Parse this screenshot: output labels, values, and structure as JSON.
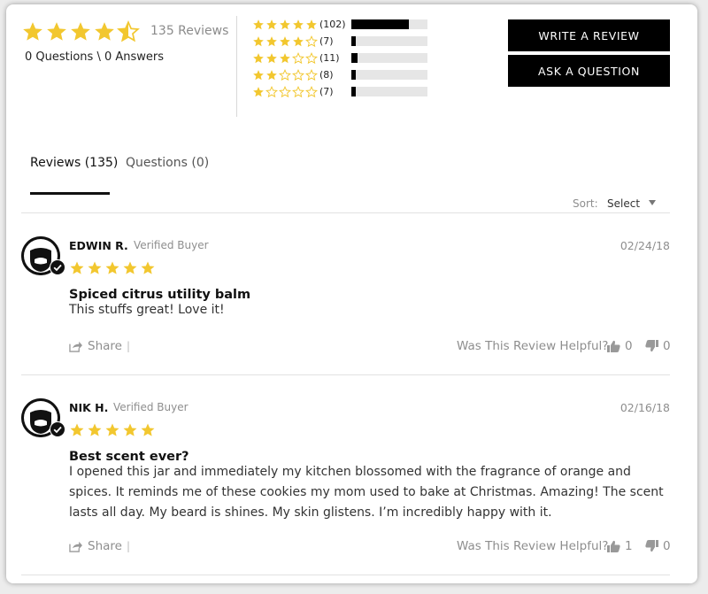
{
  "summary": {
    "rating": 4.5,
    "review_count": "135 Reviews",
    "qa_count": "0 Questions \\ 0 Answers"
  },
  "histogram": [
    {
      "stars": 5,
      "count": "(102)",
      "fraction": 0.755
    },
    {
      "stars": 4,
      "count": "(7)",
      "fraction": 0.052
    },
    {
      "stars": 3,
      "count": "(11)",
      "fraction": 0.081
    },
    {
      "stars": 2,
      "count": "(8)",
      "fraction": 0.059
    },
    {
      "stars": 1,
      "count": "(7)",
      "fraction": 0.052
    }
  ],
  "actions": {
    "write_review": "WRITE A REVIEW",
    "ask_question": "ASK A QUESTION"
  },
  "tabs": {
    "reviews": "Reviews (135)",
    "questions": "Questions (0)"
  },
  "sort": {
    "label": "Sort:",
    "value": "Select"
  },
  "reviews": [
    {
      "name": "EDWIN R.",
      "badge": "Verified Buyer",
      "date": "02/24/18",
      "rating": 5,
      "title": "Spiced citrus utility balm",
      "body": "This stuffs great! Love it!",
      "share": "Share",
      "pipe": "|",
      "helpful": "Was This Review Helpful?",
      "up": "0",
      "down": "0"
    },
    {
      "name": "NIK H.",
      "badge": "Verified Buyer",
      "date": "02/16/18",
      "rating": 5,
      "title": "Best scent ever?",
      "body": "I opened this jar and immediately my kitchen blossomed with the fragrance of orange and spices. It reminds me of these cookies my mom used to bake at Christmas. Amazing! The scent lasts all day. My beard is shines. My skin glistens. I’m incredibly happy with it.",
      "share": "Share",
      "pipe": "|",
      "helpful": "Was This Review Helpful?",
      "up": "1",
      "down": "0"
    }
  ],
  "colors": {
    "star": "#f2c72f",
    "button_bg": "#000000",
    "muted_text": "#8e8e8e"
  },
  "icons": [
    "star-icon",
    "verified-check-icon",
    "share-icon",
    "thumbs-up-icon",
    "thumbs-down-icon",
    "avatar-beard-icon",
    "chevron-down-icon"
  ]
}
